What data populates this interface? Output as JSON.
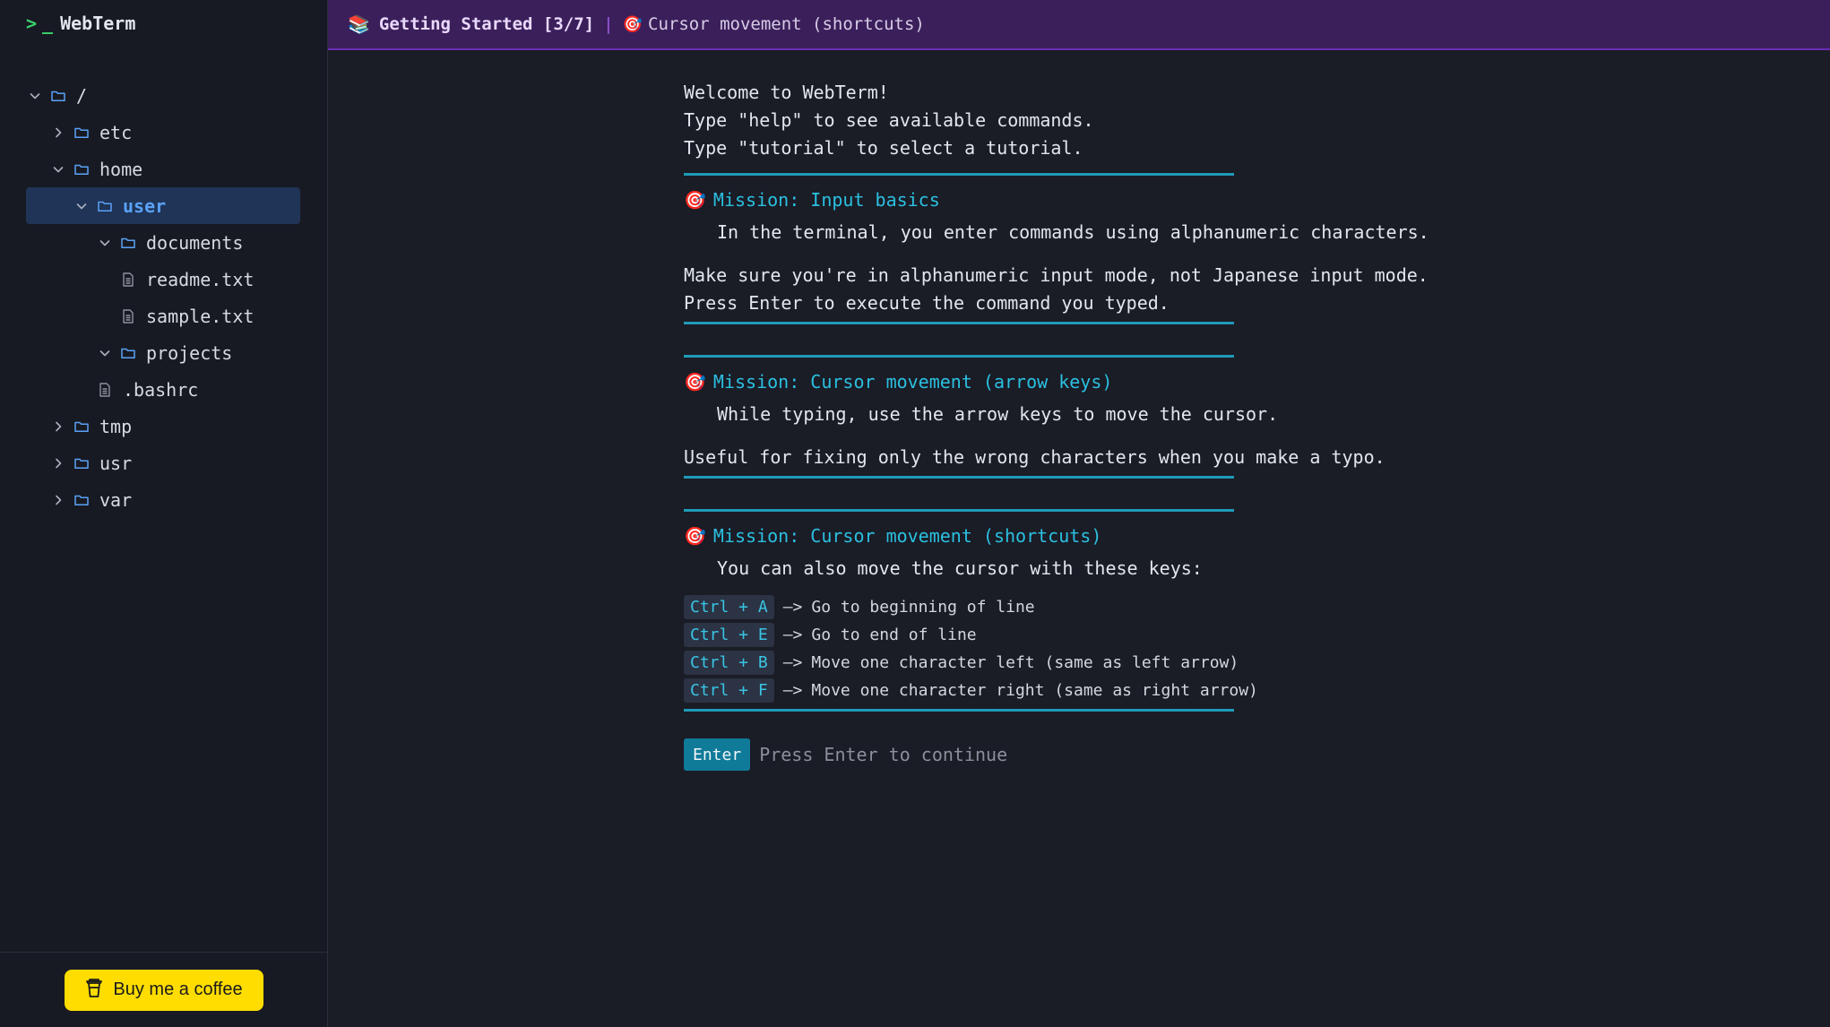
{
  "app": {
    "name": "WebTerm",
    "prompt_symbol": ">",
    "cursor_symbol": "_"
  },
  "sidebar": {
    "tree": [
      {
        "label": "/",
        "type": "folder",
        "depth": 0,
        "expanded": true
      },
      {
        "label": "etc",
        "type": "folder",
        "depth": 1,
        "expanded": false
      },
      {
        "label": "home",
        "type": "folder",
        "depth": 1,
        "expanded": true
      },
      {
        "label": "user",
        "type": "folder",
        "depth": 2,
        "expanded": true,
        "selected": true
      },
      {
        "label": "documents",
        "type": "folder",
        "depth": 3,
        "expanded": true
      },
      {
        "label": "readme.txt",
        "type": "file",
        "depth": 4
      },
      {
        "label": "sample.txt",
        "type": "file",
        "depth": 4
      },
      {
        "label": "projects",
        "type": "folder",
        "depth": 3,
        "expanded": true
      },
      {
        "label": ".bashrc",
        "type": "file",
        "depth": 3
      },
      {
        "label": "tmp",
        "type": "folder",
        "depth": 1,
        "expanded": false
      },
      {
        "label": "usr",
        "type": "folder",
        "depth": 1,
        "expanded": false
      },
      {
        "label": "var",
        "type": "folder",
        "depth": 1,
        "expanded": false
      }
    ],
    "coffee_label": "Buy me a coffee"
  },
  "topbar": {
    "tutorial_title": "Getting Started [3/7]",
    "separator": "|",
    "mission_name": "Cursor movement (shortcuts)"
  },
  "terminal": {
    "welcome": [
      "Welcome to WebTerm!",
      "Type \"help\" to see available commands.",
      "Type \"tutorial\" to select a tutorial."
    ],
    "mission1": {
      "title": "Mission: Input basics",
      "intro": "In the terminal, you enter commands using alphanumeric characters.",
      "body": [
        "Make sure you're in alphanumeric input mode, not Japanese input mode.",
        "Press Enter to execute the command you typed."
      ]
    },
    "mission2": {
      "title": "Mission: Cursor movement (arrow keys)",
      "intro": "While typing, use the arrow keys to move the cursor.",
      "body": [
        "Useful for fixing only the wrong characters when you make a typo."
      ]
    },
    "mission3": {
      "title": "Mission: Cursor movement (shortcuts)",
      "intro": "You can also move the cursor with these keys:",
      "arrow": "—>",
      "shortcuts": [
        {
          "key": "Ctrl + A",
          "desc": "Go to beginning of line"
        },
        {
          "key": "Ctrl + E",
          "desc": "Go to end of line"
        },
        {
          "key": "Ctrl + B",
          "desc": "Move one character left (same as left arrow)"
        },
        {
          "key": "Ctrl + F",
          "desc": "Move one character right (same as right arrow)"
        }
      ]
    },
    "continue": {
      "button": "Enter",
      "text": "Press Enter to continue"
    }
  },
  "colors": {
    "accent_cyan": "#2bc0e0",
    "topbar_bg": "#3b1f5b",
    "selection_bg": "#1f3457",
    "folder_icon": "#5aa2f7",
    "coffee_yellow": "#ffdd00",
    "prompt_green": "#3ad36c"
  },
  "icons": {
    "folder": "folder-icon",
    "file": "file-icon",
    "chevron_right": "chevron-right-icon",
    "chevron_down": "chevron-down-icon",
    "coffee": "coffee-cup-icon",
    "book": "book-stack-icon",
    "target": "target-icon"
  }
}
